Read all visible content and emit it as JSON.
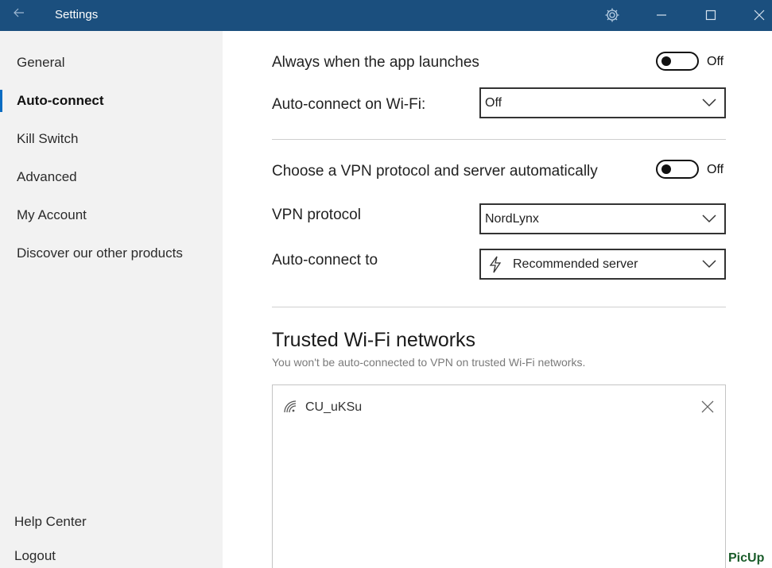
{
  "window": {
    "title": "Settings"
  },
  "sidebar": {
    "items": [
      {
        "label": "General"
      },
      {
        "label": "Auto-connect",
        "active": true
      },
      {
        "label": "Kill Switch"
      },
      {
        "label": "Advanced"
      },
      {
        "label": "My Account"
      },
      {
        "label": "Discover our other products"
      }
    ],
    "bottom": [
      {
        "label": "Help Center"
      },
      {
        "label": "Logout"
      }
    ]
  },
  "main": {
    "launch": {
      "label": "Always when the app launches",
      "state": "Off"
    },
    "wifi_autoconnect": {
      "label": "Auto-connect on Wi-Fi:",
      "value": "Off"
    },
    "protocol_auto": {
      "label": "Choose a VPN protocol and server automatically",
      "state": "Off"
    },
    "vpn_protocol": {
      "label": "VPN protocol",
      "value": "NordLynx"
    },
    "autoconnect_to": {
      "label": "Auto-connect to",
      "value": "Recommended server"
    },
    "trusted": {
      "title": "Trusted Wi-Fi networks",
      "subtitle": "You won't be auto-connected to VPN on trusted Wi-Fi networks.",
      "networks": [
        {
          "name": "CU_uKSu"
        }
      ]
    }
  },
  "watermark": "PicUp",
  "colors": {
    "titlebar": "#1b4f7e",
    "accent": "#0a6cc2",
    "sidebar_bg": "#f2f2f2"
  },
  "icons": [
    "back-arrow-icon",
    "gear-icon",
    "minimize-icon",
    "maximize-icon",
    "close-icon",
    "chevron-down-icon",
    "lightning-icon",
    "wifi-icon",
    "remove-icon"
  ]
}
